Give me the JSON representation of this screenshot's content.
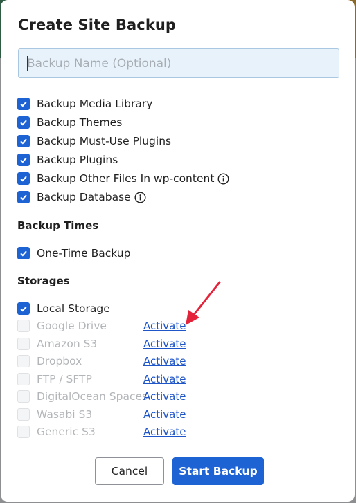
{
  "dialog": {
    "title": "Create Site Backup",
    "name_input": {
      "value": "",
      "placeholder": "Backup Name (Optional)"
    }
  },
  "content_options": [
    {
      "label": "Backup Media Library",
      "checked": true,
      "info": false
    },
    {
      "label": "Backup Themes",
      "checked": true,
      "info": false
    },
    {
      "label": "Backup Must-Use Plugins",
      "checked": true,
      "info": false
    },
    {
      "label": "Backup Plugins",
      "checked": true,
      "info": false
    },
    {
      "label": "Backup Other Files In wp-content",
      "checked": true,
      "info": true
    },
    {
      "label": "Backup Database",
      "checked": true,
      "info": true
    }
  ],
  "backup_times": {
    "heading": "Backup Times",
    "options": [
      {
        "label": "One-Time Backup",
        "checked": true
      }
    ]
  },
  "storages": {
    "heading": "Storages",
    "local": {
      "label": "Local Storage",
      "checked": true
    },
    "remote": [
      {
        "label": "Google Drive",
        "checked": false,
        "enabled": false,
        "action": "Activate"
      },
      {
        "label": "Amazon S3",
        "checked": false,
        "enabled": false,
        "action": "Activate"
      },
      {
        "label": "Dropbox",
        "checked": false,
        "enabled": false,
        "action": "Activate"
      },
      {
        "label": "FTP / SFTP",
        "checked": false,
        "enabled": false,
        "action": "Activate"
      },
      {
        "label": "DigitalOcean Spaces",
        "checked": false,
        "enabled": false,
        "action": "Activate"
      },
      {
        "label": "Wasabi S3",
        "checked": false,
        "enabled": false,
        "action": "Activate"
      },
      {
        "label": "Generic S3",
        "checked": false,
        "enabled": false,
        "action": "Activate"
      }
    ]
  },
  "buttons": {
    "cancel": "Cancel",
    "start": "Start Backup"
  },
  "colors": {
    "accent": "#1e63d4",
    "link": "#1e55c8",
    "annotation_arrow": "#e4233a"
  },
  "icons": {
    "checkbox": "checkmark-icon",
    "info": "info-circle-icon",
    "annotation": "red-arrow-icon"
  }
}
